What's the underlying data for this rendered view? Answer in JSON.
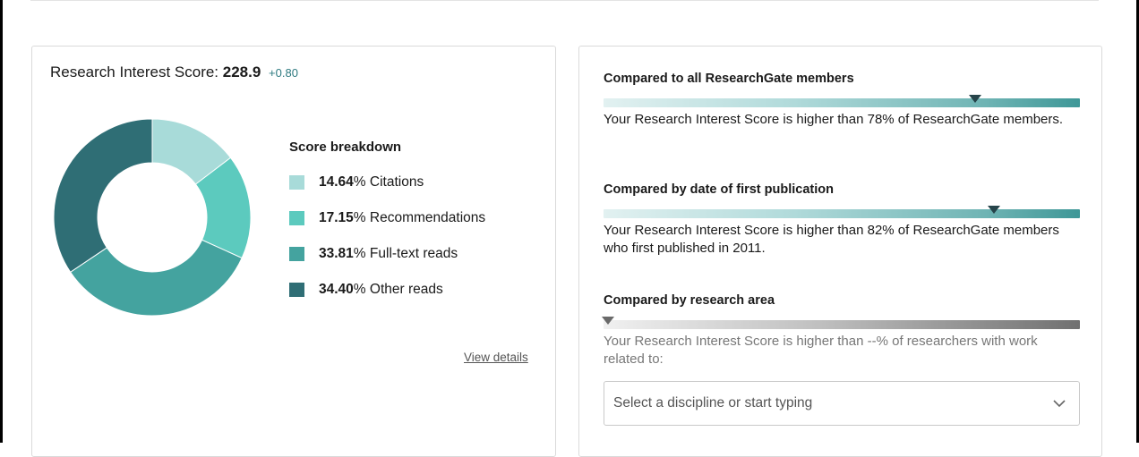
{
  "score": {
    "label": "Research Interest Score:",
    "value": "228.9",
    "delta": "+0.80"
  },
  "breakdown": {
    "title": "Score breakdown",
    "items": [
      {
        "percent": "14.64",
        "percent_suffix": "%",
        "label": "Citations",
        "value": 14.64,
        "color": "#a8dbd9"
      },
      {
        "percent": "17.15",
        "percent_suffix": "%",
        "label": "Recommendations",
        "value": 17.15,
        "color": "#5ccabe"
      },
      {
        "percent": "33.81",
        "percent_suffix": "%",
        "label": "Full-text reads",
        "value": 33.81,
        "color": "#44a39f"
      },
      {
        "percent": "34.40",
        "percent_suffix": "%",
        "label": "Other reads",
        "value": 34.4,
        "color": "#2f6e75"
      }
    ]
  },
  "view_details": "View details",
  "comparisons": [
    {
      "title": "Compared to all ResearchGate members",
      "text": "Your Research Interest Score is higher than 78% of ResearchGate members.",
      "level": 0.78
    },
    {
      "title": "Compared by date of first publication",
      "text": "Your Research Interest Score is higher than 82% of ResearchGate members who first published in 2011.",
      "level": 0.82
    },
    {
      "title": "Compared by research area",
      "text": "Your Research Interest Score is higher than --% of researchers with work related to:",
      "level": 0
    }
  ],
  "discipline_select": {
    "placeholder": "Select a discipline or start typing"
  }
}
